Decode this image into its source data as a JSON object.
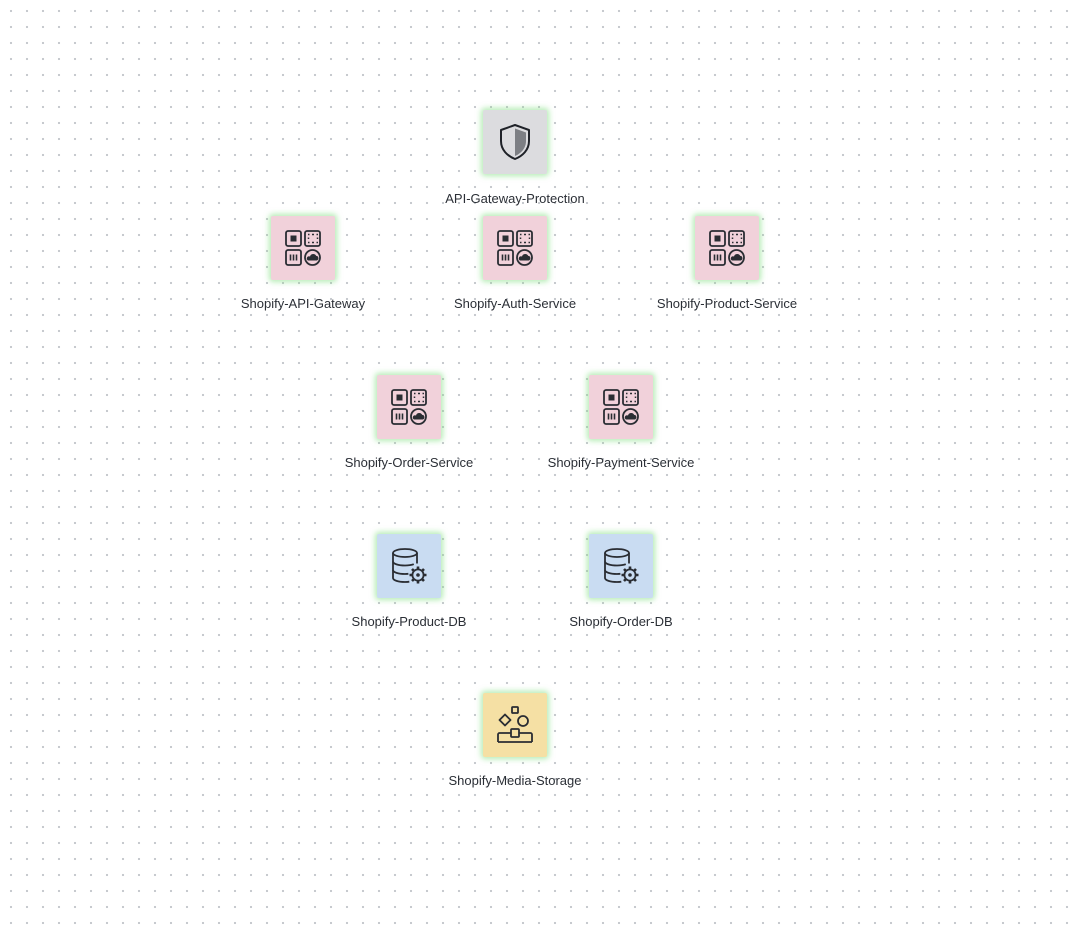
{
  "diagram": {
    "nodes": [
      {
        "id": "api-gateway-protection",
        "label": "API-Gateway-Protection",
        "kind": "security",
        "icon": "shield-icon"
      },
      {
        "id": "shopify-api-gateway",
        "label": "Shopify-API-Gateway",
        "kind": "service",
        "icon": "microservices-icon"
      },
      {
        "id": "shopify-auth-service",
        "label": "Shopify-Auth-Service",
        "kind": "service",
        "icon": "microservices-icon"
      },
      {
        "id": "shopify-product-service",
        "label": "Shopify-Product-Service",
        "kind": "service",
        "icon": "microservices-icon"
      },
      {
        "id": "shopify-order-service",
        "label": "Shopify-Order-Service",
        "kind": "service",
        "icon": "microservices-icon"
      },
      {
        "id": "shopify-payment-service",
        "label": "Shopify-Payment-Service",
        "kind": "service",
        "icon": "microservices-icon"
      },
      {
        "id": "shopify-product-db",
        "label": "Shopify-Product-DB",
        "kind": "database",
        "icon": "database-settings-icon"
      },
      {
        "id": "shopify-order-db",
        "label": "Shopify-Order-DB",
        "kind": "database",
        "icon": "database-settings-icon"
      },
      {
        "id": "shopify-media-storage",
        "label": "Shopify-Media-Storage",
        "kind": "storage",
        "icon": "object-storage-icon"
      }
    ],
    "colors": {
      "security": "#dcdcdf",
      "service": "#f1d1da",
      "database": "#c9dcf2",
      "storage": "#f5e0a4",
      "selection_glow": "#78dc78",
      "label_text": "#2b2f36"
    }
  }
}
